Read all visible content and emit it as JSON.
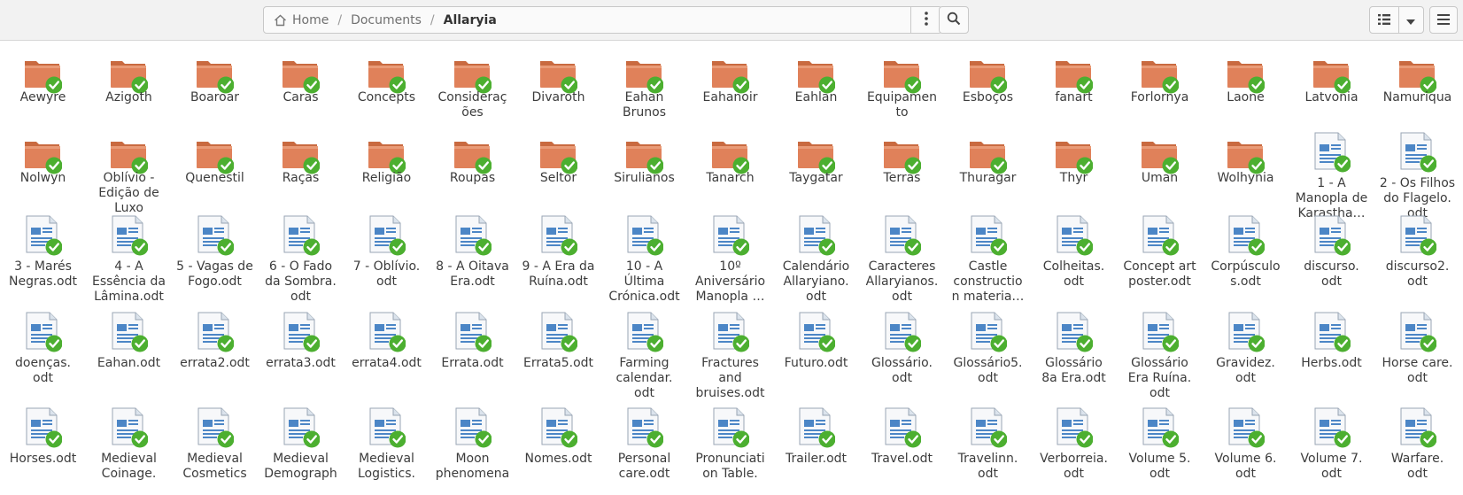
{
  "pathbar": {
    "segments": [
      {
        "label": "Home",
        "name": "breadcrumb-home"
      },
      {
        "label": "Documents",
        "name": "breadcrumb-documents"
      },
      {
        "label": "Allaryia",
        "name": "breadcrumb-allaryia"
      }
    ]
  },
  "toolbar": {
    "path_menu_icon": "vertical-dots-icon",
    "search_icon": "search-icon",
    "view_icon": "list-view-icon",
    "view_options_icon": "chevron-down-icon",
    "menu_icon": "hamburger-menu-icon"
  },
  "colors": {
    "folder": "#e0815a",
    "check": "#4caf30",
    "doc": "#4c86c6"
  },
  "items": [
    {
      "name": "Aewyre",
      "type": "folder",
      "lines": [
        "Aewyre"
      ]
    },
    {
      "name": "Azigoth",
      "type": "folder",
      "lines": [
        "Azigoth"
      ]
    },
    {
      "name": "Boaroar",
      "type": "folder",
      "lines": [
        "Boaroar"
      ]
    },
    {
      "name": "Caras",
      "type": "folder",
      "lines": [
        "Caras"
      ]
    },
    {
      "name": "Concepts",
      "type": "folder",
      "lines": [
        "Concepts"
      ]
    },
    {
      "name": "Considerações",
      "type": "folder",
      "lines": [
        "Consideraç",
        "ões"
      ]
    },
    {
      "name": "Divaroth",
      "type": "folder",
      "lines": [
        "Divaroth"
      ]
    },
    {
      "name": "Eahan Brunos",
      "type": "folder",
      "lines": [
        "Eahan",
        "Brunos"
      ]
    },
    {
      "name": "Eahanoir",
      "type": "folder",
      "lines": [
        "Eahanoir"
      ]
    },
    {
      "name": "Eahlan",
      "type": "folder",
      "lines": [
        "Eahlan"
      ]
    },
    {
      "name": "Equipamento",
      "type": "folder",
      "lines": [
        "Equipamen",
        "to"
      ]
    },
    {
      "name": "Esboços",
      "type": "folder",
      "lines": [
        "Esboços"
      ]
    },
    {
      "name": "fanart",
      "type": "folder",
      "lines": [
        "fanart"
      ]
    },
    {
      "name": "Forlornya",
      "type": "folder",
      "lines": [
        "Forlornya"
      ]
    },
    {
      "name": "Laone",
      "type": "folder",
      "lines": [
        "Laone"
      ]
    },
    {
      "name": "Latvonia",
      "type": "folder",
      "lines": [
        "Latvonia"
      ]
    },
    {
      "name": "Namuriqua",
      "type": "folder",
      "lines": [
        "Namuriqua"
      ]
    },
    {
      "name": "Nolwyn",
      "type": "folder",
      "lines": [
        "Nolwyn"
      ]
    },
    {
      "name": "Oblívio - Edição de Luxo",
      "type": "folder",
      "lines": [
        "Oblívio -",
        "Edição de",
        "Luxo"
      ]
    },
    {
      "name": "Quenestil",
      "type": "folder",
      "lines": [
        "Quenestil"
      ]
    },
    {
      "name": "Raças",
      "type": "folder",
      "lines": [
        "Raças"
      ]
    },
    {
      "name": "Religião",
      "type": "folder",
      "lines": [
        "Religião"
      ]
    },
    {
      "name": "Roupas",
      "type": "folder",
      "lines": [
        "Roupas"
      ]
    },
    {
      "name": "Seltor",
      "type": "folder",
      "lines": [
        "Seltor"
      ]
    },
    {
      "name": "Sirulianos",
      "type": "folder",
      "lines": [
        "Sirulianos"
      ]
    },
    {
      "name": "Tanarch",
      "type": "folder",
      "lines": [
        "Tanarch"
      ]
    },
    {
      "name": "Taygatar",
      "type": "folder",
      "lines": [
        "Taygatar"
      ]
    },
    {
      "name": "Terras",
      "type": "folder",
      "lines": [
        "Terras"
      ]
    },
    {
      "name": "Thuragar",
      "type": "folder",
      "lines": [
        "Thuragar"
      ]
    },
    {
      "name": "Thyr",
      "type": "folder",
      "lines": [
        "Thyr"
      ]
    },
    {
      "name": "Uman",
      "type": "folder",
      "lines": [
        "Uman"
      ]
    },
    {
      "name": "Wolhynia",
      "type": "folder",
      "lines": [
        "Wolhynia"
      ]
    },
    {
      "name": "1 - A Manopla de Karastha…",
      "type": "doc",
      "lines": [
        "1 - A",
        "Manopla de",
        "Karastha…"
      ]
    },
    {
      "name": "2 - Os Filhos do Flagelo.odt",
      "type": "doc",
      "lines": [
        "2 - Os Filhos",
        "do Flagelo.",
        "odt"
      ]
    },
    {
      "name": "3 - Marés Negras.odt",
      "type": "doc",
      "lines": [
        "3 - Marés",
        "Negras.odt"
      ]
    },
    {
      "name": "4 - A Essência da Lâmina.odt",
      "type": "doc",
      "lines": [
        "4 - A",
        "Essência da",
        "Lâmina.odt"
      ]
    },
    {
      "name": "5 - Vagas de Fogo.odt",
      "type": "doc",
      "lines": [
        "5 - Vagas de",
        "Fogo.odt"
      ]
    },
    {
      "name": "6 - O Fado da Sombra.odt",
      "type": "doc",
      "lines": [
        "6 - O Fado",
        "da Sombra.",
        "odt"
      ]
    },
    {
      "name": "7 - Oblívio.odt",
      "type": "doc",
      "lines": [
        "7 - Oblívio.",
        "odt"
      ]
    },
    {
      "name": "8 - A Oitava Era.odt",
      "type": "doc",
      "lines": [
        "8 - A Oitava",
        "Era.odt"
      ]
    },
    {
      "name": "9 - A Era da Ruína.odt",
      "type": "doc",
      "lines": [
        "9 - A Era da",
        "Ruína.odt"
      ]
    },
    {
      "name": "10 - A Última Crónica.odt",
      "type": "doc",
      "lines": [
        "10 - A",
        "Última",
        "Crónica.odt"
      ]
    },
    {
      "name": "10º Aniversário Manopla …",
      "type": "doc",
      "lines": [
        "10º",
        "Aniversário",
        "Manopla …"
      ]
    },
    {
      "name": "Calendário Allaryiano.odt",
      "type": "doc",
      "lines": [
        "Calendário",
        "Allaryiano.",
        "odt"
      ]
    },
    {
      "name": "Caracteres Allaryianos.odt",
      "type": "doc",
      "lines": [
        "Caracteres",
        "Allaryianos.",
        "odt"
      ]
    },
    {
      "name": "Castle construction materia…",
      "type": "doc",
      "lines": [
        "Castle",
        "constructio",
        "n materia…"
      ]
    },
    {
      "name": "Colheitas.odt",
      "type": "doc",
      "lines": [
        "Colheitas.",
        "odt"
      ]
    },
    {
      "name": "Concept art poster.odt",
      "type": "doc",
      "lines": [
        "Concept art",
        "poster.odt"
      ]
    },
    {
      "name": "Corpúsculos.odt",
      "type": "doc",
      "lines": [
        "Corpúsculo",
        "s.odt"
      ]
    },
    {
      "name": "discurso.odt",
      "type": "doc",
      "lines": [
        "discurso.",
        "odt"
      ]
    },
    {
      "name": "discurso2.odt",
      "type": "doc",
      "lines": [
        "discurso2.",
        "odt"
      ]
    },
    {
      "name": "doenças.odt",
      "type": "doc",
      "lines": [
        "doenças.",
        "odt"
      ]
    },
    {
      "name": "Eahan.odt",
      "type": "doc",
      "lines": [
        "Eahan.odt"
      ]
    },
    {
      "name": "errata2.odt",
      "type": "doc",
      "lines": [
        "errata2.odt"
      ]
    },
    {
      "name": "errata3.odt",
      "type": "doc",
      "lines": [
        "errata3.odt"
      ]
    },
    {
      "name": "errata4.odt",
      "type": "doc",
      "lines": [
        "errata4.odt"
      ]
    },
    {
      "name": "Errata.odt",
      "type": "doc",
      "lines": [
        "Errata.odt"
      ]
    },
    {
      "name": "Errata5.odt",
      "type": "doc",
      "lines": [
        "Errata5.odt"
      ]
    },
    {
      "name": "Farming calendar.odt",
      "type": "doc",
      "lines": [
        "Farming",
        "calendar.",
        "odt"
      ]
    },
    {
      "name": "Fractures and bruises.odt",
      "type": "doc",
      "lines": [
        "Fractures",
        "and",
        "bruises.odt"
      ]
    },
    {
      "name": "Futuro.odt",
      "type": "doc",
      "lines": [
        "Futuro.odt"
      ]
    },
    {
      "name": "Glossário.odt",
      "type": "doc",
      "lines": [
        "Glossário.",
        "odt"
      ]
    },
    {
      "name": "Glossário5.odt",
      "type": "doc",
      "lines": [
        "Glossário5.",
        "odt"
      ]
    },
    {
      "name": "Glossário 8a Era.odt",
      "type": "doc",
      "lines": [
        "Glossário",
        "8a Era.odt"
      ]
    },
    {
      "name": "Glossário Era Ruína.odt",
      "type": "doc",
      "lines": [
        "Glossário",
        "Era Ruína.",
        "odt"
      ]
    },
    {
      "name": "Gravidez.odt",
      "type": "doc",
      "lines": [
        "Gravidez.",
        "odt"
      ]
    },
    {
      "name": "Herbs.odt",
      "type": "doc",
      "lines": [
        "Herbs.odt"
      ]
    },
    {
      "name": "Horse care.odt",
      "type": "doc",
      "lines": [
        "Horse care.",
        "odt"
      ]
    },
    {
      "name": "Horses.odt",
      "type": "doc",
      "lines": [
        "Horses.odt"
      ]
    },
    {
      "name": "Medieval Coinage.odt",
      "type": "doc",
      "lines": [
        "Medieval",
        "Coinage."
      ]
    },
    {
      "name": "Medieval Cosmetics",
      "type": "doc",
      "lines": [
        "Medieval",
        "Cosmetics"
      ]
    },
    {
      "name": "Medieval Demography",
      "type": "doc",
      "lines": [
        "Medieval",
        "Demograph"
      ]
    },
    {
      "name": "Medieval Logistics.",
      "type": "doc",
      "lines": [
        "Medieval",
        "Logistics."
      ]
    },
    {
      "name": "Moon phenomena",
      "type": "doc",
      "lines": [
        "Moon",
        "phenomena"
      ]
    },
    {
      "name": "Nomes.odt",
      "type": "doc",
      "lines": [
        "Nomes.odt"
      ]
    },
    {
      "name": "Personal care.odt",
      "type": "doc",
      "lines": [
        "Personal",
        "care.odt"
      ]
    },
    {
      "name": "Pronunciation Table.",
      "type": "doc",
      "lines": [
        "Pronunciati",
        "on Table."
      ]
    },
    {
      "name": "Trailer.odt",
      "type": "doc",
      "lines": [
        "Trailer.odt"
      ]
    },
    {
      "name": "Travel.odt",
      "type": "doc",
      "lines": [
        "Travel.odt"
      ]
    },
    {
      "name": "Travelinn.odt",
      "type": "doc",
      "lines": [
        "Travelinn.",
        "odt"
      ]
    },
    {
      "name": "Verborreia.odt",
      "type": "doc",
      "lines": [
        "Verborreia.",
        "odt"
      ]
    },
    {
      "name": "Volume 5.odt",
      "type": "doc",
      "lines": [
        "Volume 5.",
        "odt"
      ]
    },
    {
      "name": "Volume 6.odt",
      "type": "doc",
      "lines": [
        "Volume 6.",
        "odt"
      ]
    },
    {
      "name": "Volume 7.odt",
      "type": "doc",
      "lines": [
        "Volume 7.",
        "odt"
      ]
    },
    {
      "name": "Warfare.odt",
      "type": "doc",
      "lines": [
        "Warfare.",
        "odt"
      ]
    }
  ]
}
